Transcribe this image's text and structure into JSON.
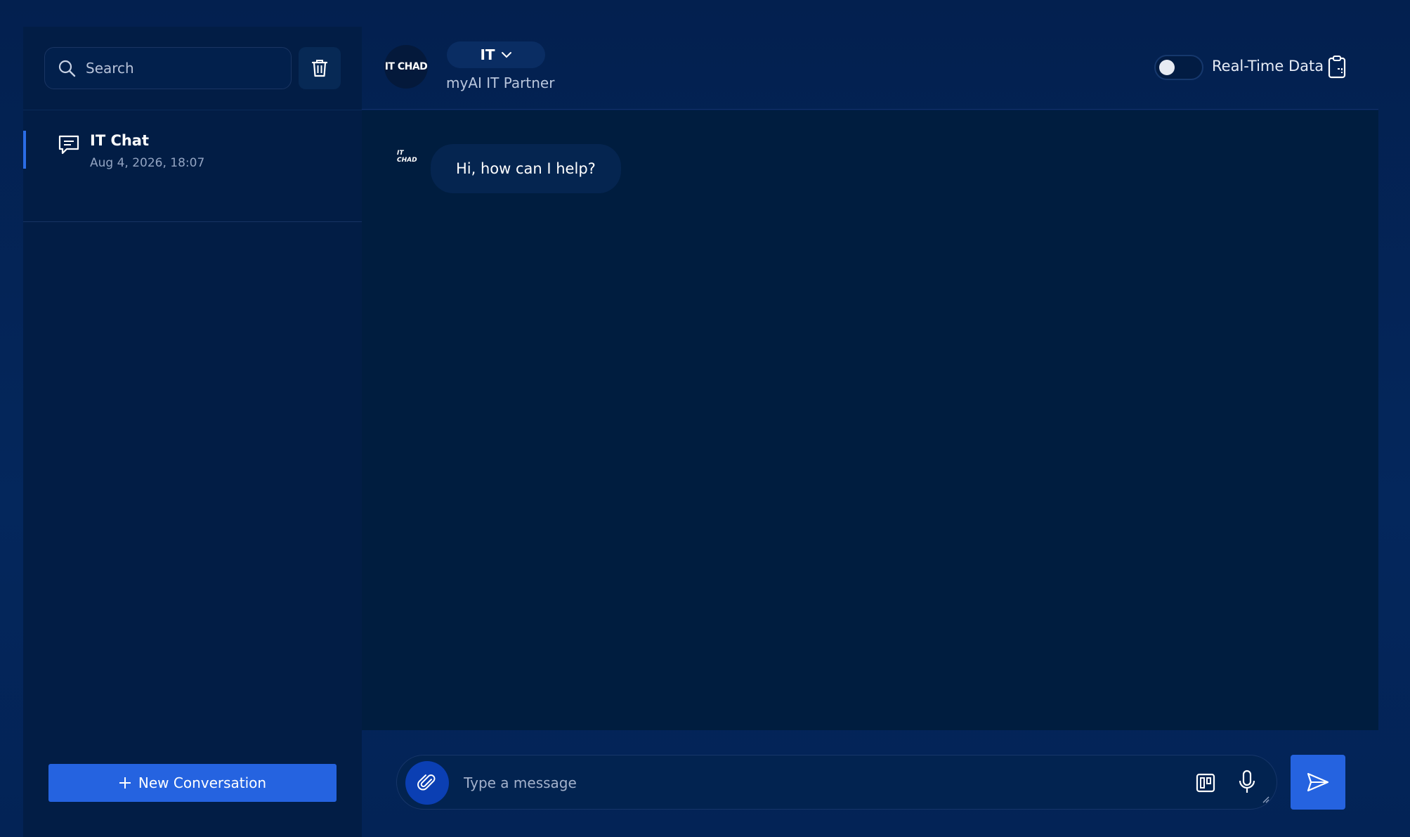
{
  "sidebar": {
    "search": {
      "placeholder": "Search",
      "value": ""
    },
    "conversations": [
      {
        "title": "IT Chat",
        "date": "Aug 4, 2026, 18:07",
        "active": true
      }
    ],
    "new_conversation_label": "New Conversation"
  },
  "header": {
    "avatar_text": "IT CHAD",
    "department": "IT",
    "subtitle": "myAI IT Partner",
    "realtime_label": "Real-Time Data",
    "realtime_enabled": false
  },
  "chat": {
    "messages": [
      {
        "sender": "bot",
        "avatar_text": "IT CHAD",
        "text": "Hi, how can I help?"
      }
    ]
  },
  "composer": {
    "placeholder": "Type a message",
    "value": ""
  },
  "colors": {
    "background": "#022050",
    "sidebar": "#021d45",
    "chat": "#001d3f",
    "accent": "#2563e0",
    "bubble": "#052550"
  },
  "icons": {
    "search": "search-icon",
    "trash": "trash-icon",
    "chat": "chat-bubble-icon",
    "plus": "plus-icon",
    "chevron": "chevron-down-icon",
    "clipboard": "clipboard-icon",
    "attach": "paperclip-icon",
    "board": "board-icon",
    "mic": "microphone-icon",
    "send": "send-icon"
  }
}
